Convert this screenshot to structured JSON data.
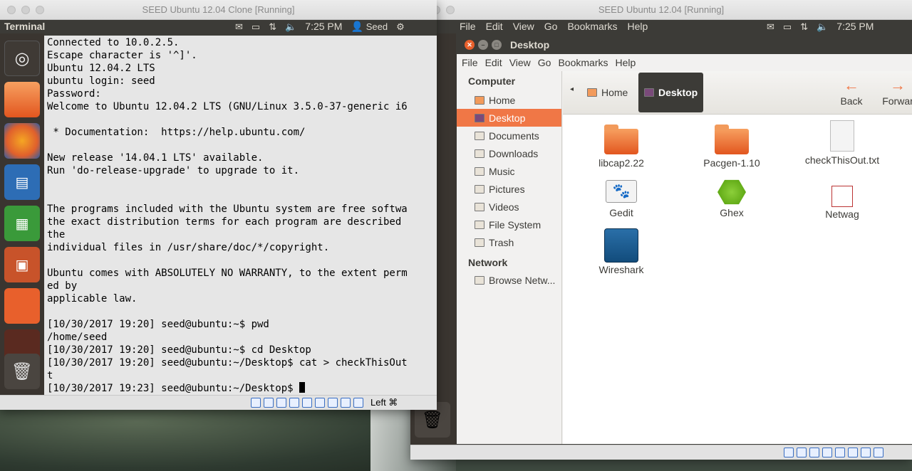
{
  "left_window": {
    "title": "SEED Ubuntu 12.04 Clone [Running]",
    "panel_label": "Terminal",
    "time": "7:25 PM",
    "user": "Seed",
    "terminal_lines": [
      "Connected to 10.0.2.5.",
      "Escape character is '^]'.",
      "Ubuntu 12.04.2 LTS",
      "ubuntu login: seed",
      "Password:",
      "Welcome to Ubuntu 12.04.2 LTS (GNU/Linux 3.5.0-37-generic i6",
      "",
      " * Documentation:  https://help.ubuntu.com/",
      "",
      "New release '14.04.1 LTS' available.",
      "Run 'do-release-upgrade' to upgrade to it.",
      "",
      "",
      "The programs included with the Ubuntu system are free softwa",
      "the exact distribution terms for each program are described",
      "the",
      "individual files in /usr/share/doc/*/copyright.",
      "",
      "Ubuntu comes with ABSOLUTELY NO WARRANTY, to the extent perm",
      "ed by",
      "applicable law.",
      "",
      "[10/30/2017 19:20] seed@ubuntu:~$ pwd",
      "/home/seed",
      "[10/30/2017 19:20] seed@ubuntu:~$ cd Desktop",
      "[10/30/2017 19:20] seed@ubuntu:~/Desktop$ cat > checkThisOut",
      "t"
    ],
    "prompt_line": "[10/30/2017 19:23] seed@ubuntu:~/Desktop$ ",
    "host_key": "Left ⌘"
  },
  "right_window": {
    "title": "SEED Ubuntu 12.04 [Running]",
    "panel_menu": [
      "File",
      "Edit",
      "View",
      "Go",
      "Bookmarks",
      "Help"
    ],
    "time": "7:25 PM",
    "nautilus": {
      "title": "Desktop",
      "menu": [
        "File",
        "Edit",
        "View",
        "Go",
        "Bookmarks",
        "Help"
      ],
      "sidebar": {
        "computer_heading": "Computer",
        "computer_items": [
          "Home",
          "Desktop",
          "Documents",
          "Downloads",
          "Music",
          "Pictures",
          "Videos",
          "File System",
          "Trash"
        ],
        "network_heading": "Network",
        "network_items": [
          "Browse Netw..."
        ]
      },
      "breadcrumbs": [
        "Home",
        "Desktop"
      ],
      "back_label": "Back",
      "forward_label": "Forwar",
      "files": [
        "libcap2.22",
        "Pacgen-1.10",
        "checkThisOut.txt",
        "Gedit",
        "Ghex",
        "Netwag",
        "Wireshark"
      ]
    }
  },
  "colors": {
    "accent": "#f07746",
    "panel": "#3c3b37",
    "launcher": "#3a3530"
  }
}
